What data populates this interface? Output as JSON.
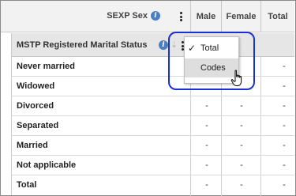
{
  "column_header": {
    "variable_label": "SEXP Sex",
    "columns": [
      "Male",
      "Female",
      "Total"
    ]
  },
  "row_header": {
    "variable_label": "MSTP Registered Marital Status"
  },
  "rows": [
    {
      "label": "Never married",
      "values": [
        "",
        "",
        "-"
      ]
    },
    {
      "label": "Widowed",
      "values": [
        "",
        "",
        "-"
      ]
    },
    {
      "label": "Divorced",
      "values": [
        "-",
        "-",
        "-"
      ]
    },
    {
      "label": "Separated",
      "values": [
        "-",
        "-",
        "-"
      ]
    },
    {
      "label": "Married",
      "values": [
        "-",
        "-",
        "-"
      ]
    },
    {
      "label": "Not applicable",
      "values": [
        "-",
        "-",
        "-"
      ]
    },
    {
      "label": "Total",
      "values": [
        "-",
        "-",
        "-"
      ]
    }
  ],
  "dropdown": {
    "items": [
      {
        "label": "Total",
        "checked": true
      },
      {
        "label": "Codes",
        "checked": false
      }
    ]
  },
  "icons": {
    "info": "info-icon",
    "menu": "kebab-menu-icon",
    "check": "check-icon",
    "cursor": "hand-pointer-icon"
  },
  "colors": {
    "info": "#4a7fc1",
    "highlight_ring": "#1a2fd6",
    "header_bg": "#f2f2f2",
    "row_header_bg": "#e6e6e6"
  }
}
